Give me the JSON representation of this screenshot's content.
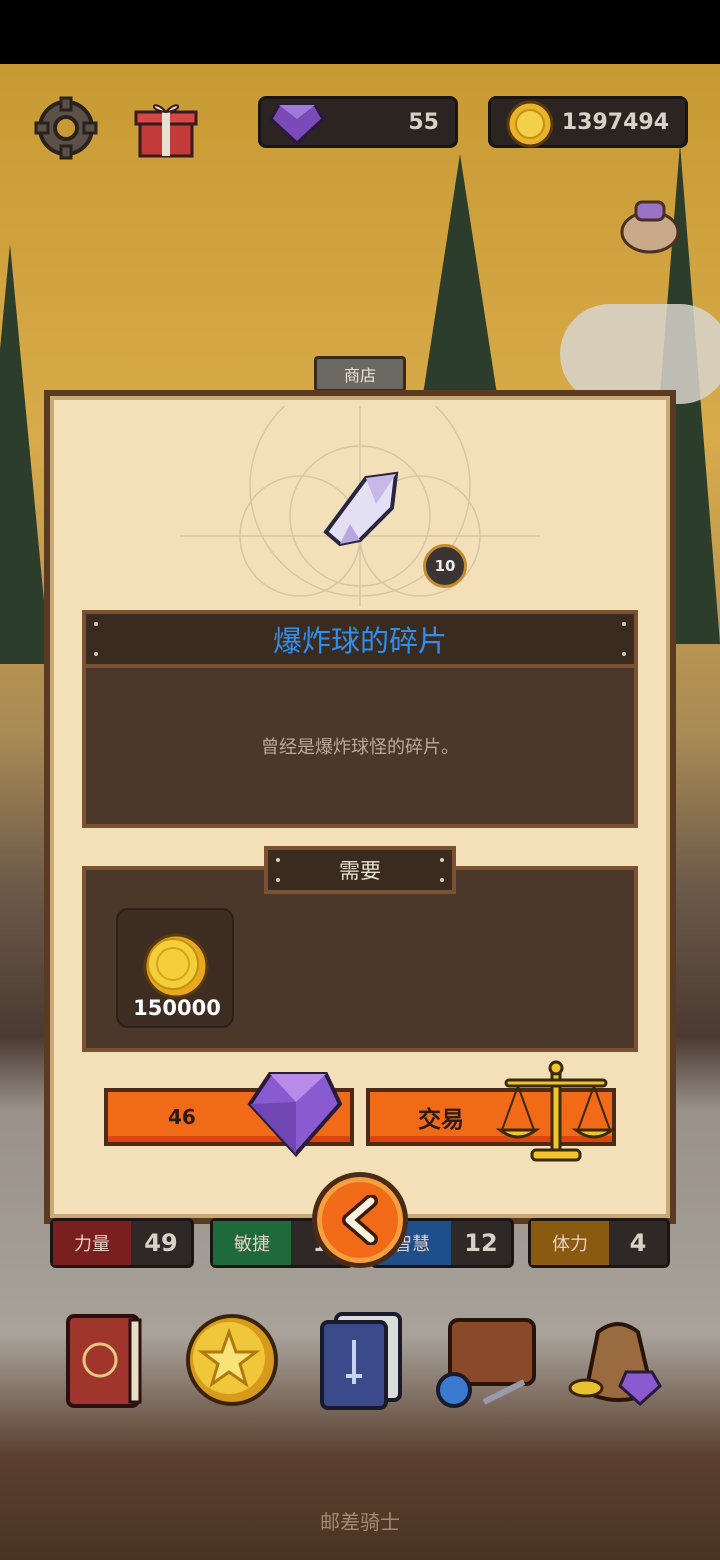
{
  "hud": {
    "gems": "55",
    "coins": "1397494"
  },
  "shop": {
    "tab_label": "商店",
    "item_count": "10",
    "item_name": "爆炸球的碎片",
    "item_desc": "曾经是爆炸球怪的碎片。",
    "need_label": "需要",
    "need_cost": "150000",
    "gem_button_value": "46",
    "trade_button_label": "交易"
  },
  "stats": [
    {
      "label": "力量",
      "value": "49",
      "color": "#7a1f1f"
    },
    {
      "label": "敏捷",
      "value": "1",
      "color": "#1f6a3a"
    },
    {
      "label": "智慧",
      "value": "12",
      "color": "#1f4f8a"
    },
    {
      "label": "体力",
      "value": "4",
      "color": "#8a5a10"
    }
  ],
  "footer": {
    "title": "邮差骑士"
  }
}
